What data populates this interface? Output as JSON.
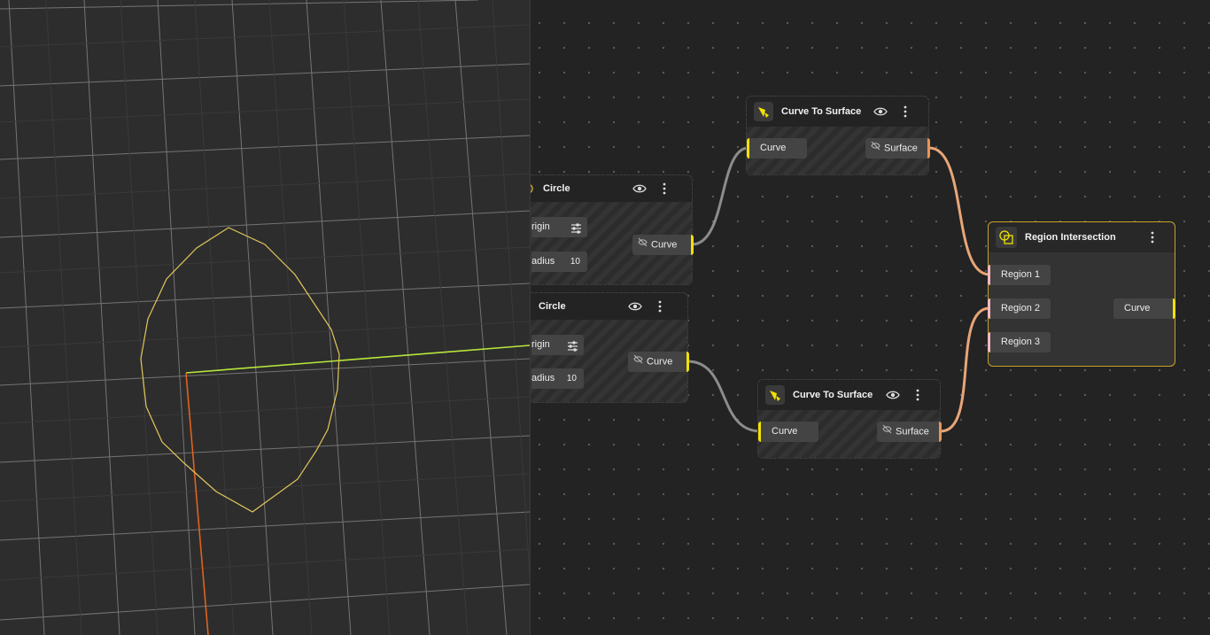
{
  "nodes": {
    "circle_a": {
      "title": "Circle",
      "origin_label": "rigin",
      "radius_label": "adius",
      "radius_value": "10",
      "output_label": "Curve"
    },
    "circle_b": {
      "title": "Circle",
      "origin_label": "rigin",
      "radius_label": "adius",
      "radius_value": "10",
      "output_label": "Curve"
    },
    "curve_to_surface_a": {
      "title": "Curve To Surface",
      "input_label": "Curve",
      "output_label": "Surface"
    },
    "curve_to_surface_b": {
      "title": "Curve To Surface",
      "input_label": "Curve",
      "output_label": "Surface"
    },
    "region_intersection": {
      "title": "Region Intersection",
      "inputs": [
        "Region 1",
        "Region 2",
        "Region 3"
      ],
      "output_label": "Curve"
    }
  },
  "colors": {
    "curve_port": "#f2e200",
    "surface_port": "#e8965a",
    "region_port": "#f3b7c2",
    "curve_wire": "#8c8c8c",
    "surface_wire": "#e8a677",
    "selected_border": "#c9a227",
    "shape_outline": "#e2c75b",
    "axis_x": "#c8e63a",
    "axis_y": "#e0621e"
  },
  "icons": {
    "node_menu": "vertical-ellipsis-icon",
    "visibility": "eye-icon",
    "hidden": "eye-off-icon",
    "settings": "sliders-icon",
    "curve_to_surface": "cube-cursor-icon",
    "circle": "circle-icon",
    "region_intersection": "overlapping-shapes-icon"
  }
}
